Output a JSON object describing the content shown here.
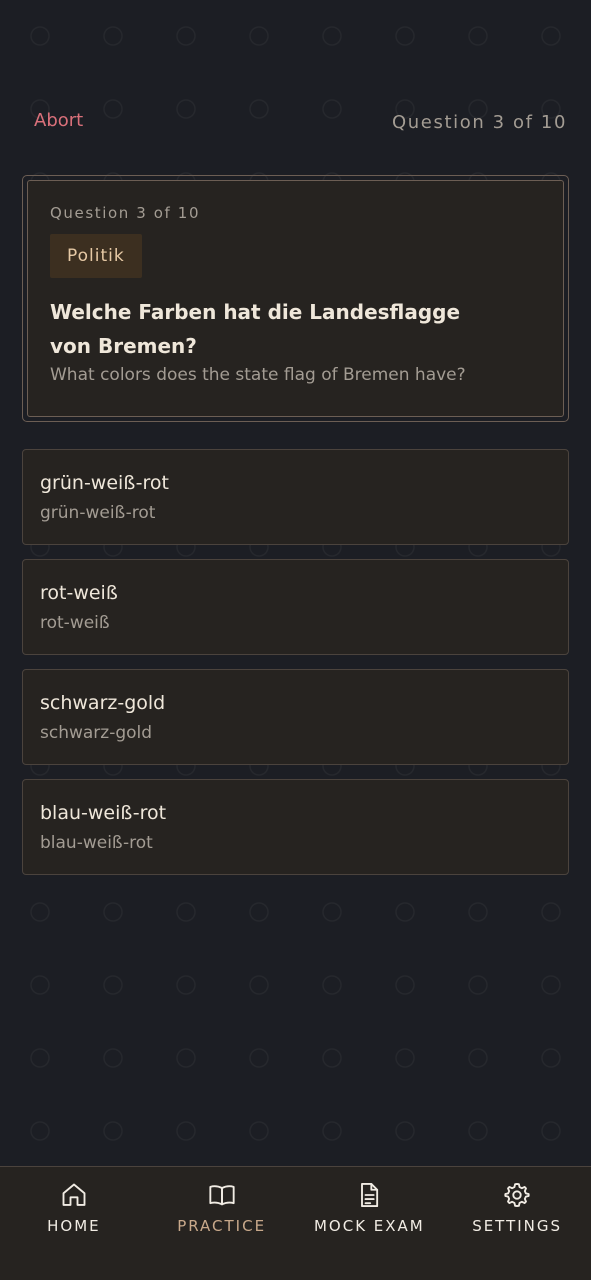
{
  "header": {
    "abort_label": "Abort",
    "progress": "Question 3 of 10"
  },
  "question": {
    "number_label": "Question 3 of 10",
    "category": "Politik",
    "text": "Welche Farben hat die Landesflagge von Bremen?",
    "translation": "What colors does the state flag of Bremen have?"
  },
  "answers": [
    {
      "text": "grün-weiß-rot",
      "translation": "grün-weiß-rot"
    },
    {
      "text": "rot-weiß",
      "translation": "rot-weiß"
    },
    {
      "text": "schwarz-gold",
      "translation": "schwarz-gold"
    },
    {
      "text": "blau-weiß-rot",
      "translation": "blau-weiß-rot"
    }
  ],
  "nav": {
    "items": [
      {
        "label": "HOME",
        "icon": "home-icon"
      },
      {
        "label": "PRACTICE",
        "icon": "book-icon"
      },
      {
        "label": "MOCK EXAM",
        "icon": "document-icon"
      },
      {
        "label": "SETTINGS",
        "icon": "gear-icon"
      }
    ]
  },
  "colors": {
    "background": "#1c1e24",
    "card": "#262320",
    "accent_red": "#d9707a",
    "tag_bg": "#3c2f20",
    "nav_inactive": "#c9a98b"
  }
}
